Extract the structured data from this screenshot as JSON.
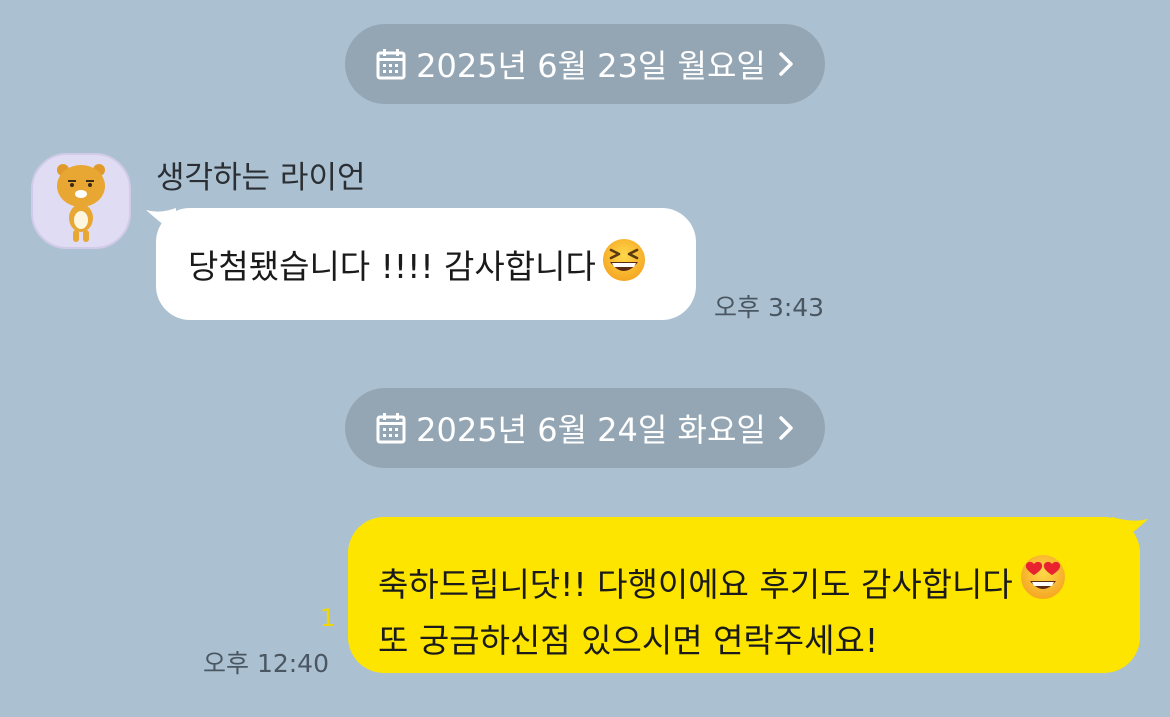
{
  "date_dividers": [
    {
      "label": "2025년 6월 23일 월요일",
      "icon": "calendar-icon"
    },
    {
      "label": "2025년 6월 24일 화요일",
      "icon": "calendar-icon"
    }
  ],
  "incoming": {
    "sender_name": "생각하는 라이언",
    "avatar": "ryan-character-avatar",
    "text": "당첨됐습니다 !!!! 감사합니다",
    "emoji": "grinning-squinting-face",
    "time": "오후 3:43"
  },
  "outgoing": {
    "line1": "축하드립니닷!! 다행이에요 후기도 감사합니다",
    "line1_emoji": "heart-eyes-face",
    "line2": "또 궁금하신점 있으시면 연락주세요!",
    "unread_count": "1",
    "time": "오후 12:40"
  },
  "colors": {
    "background": "#abc1d1",
    "date_pill": "#94a6b4",
    "outgoing_bubble": "#fee500",
    "incoming_bubble": "#ffffff",
    "unread_count": "#f2d600"
  }
}
